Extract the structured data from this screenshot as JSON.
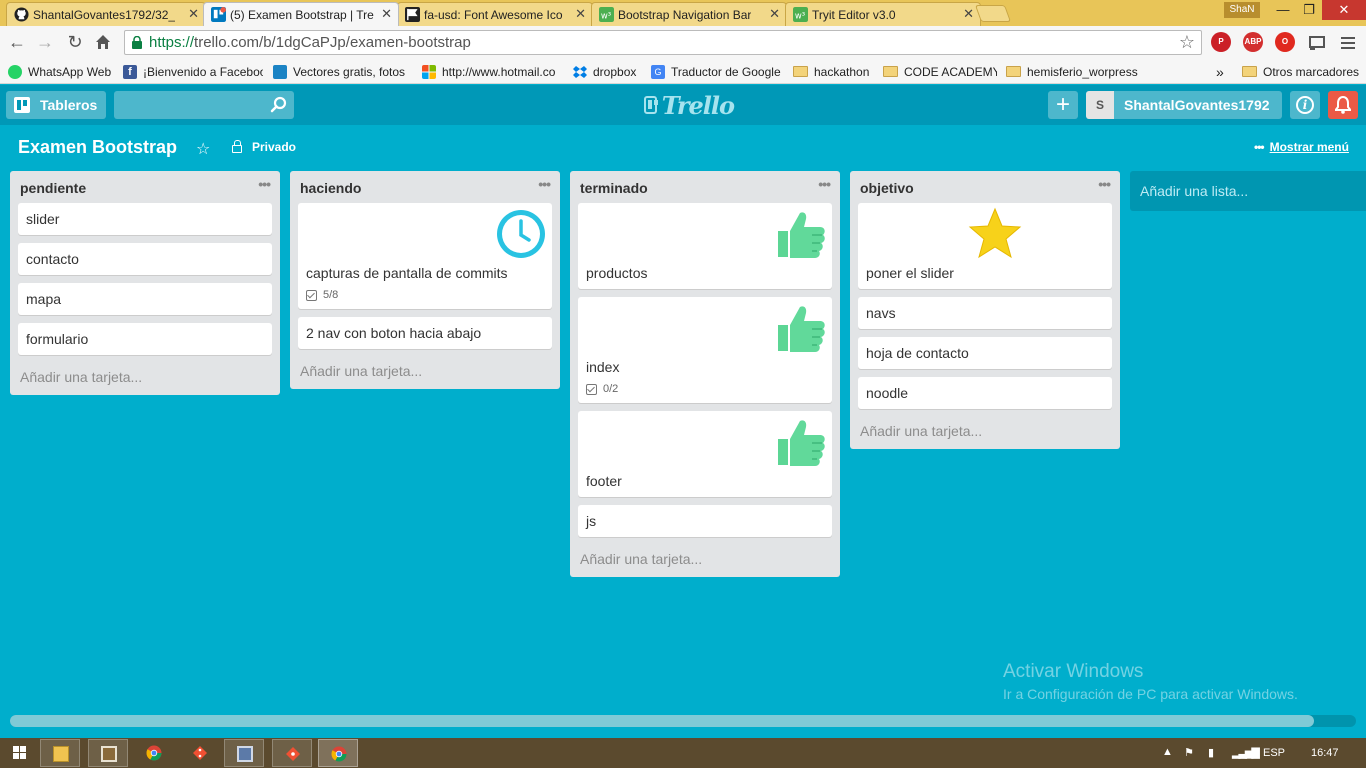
{
  "browser": {
    "tabs": [
      {
        "title": "ShantalGovantes1792/32_",
        "favicon": "github-icon",
        "active": false
      },
      {
        "title": "(5) Examen Bootstrap | Tre",
        "favicon": "trello-icon",
        "active": true
      },
      {
        "title": "fa-usd: Font Awesome Ico",
        "favicon": "fontawesome-flag-icon",
        "active": false
      },
      {
        "title": "Bootstrap Navigation Bar",
        "favicon": "w3schools-icon",
        "active": false
      },
      {
        "title": "Tryit Editor v3.0",
        "favicon": "w3schools-icon",
        "active": false
      }
    ],
    "tab_close_glyph": "✕",
    "profile_name": "ShaN",
    "url_scheme": "https://",
    "url_rest": "trello.com/b/1dgCaPJp/examen-bootstrap",
    "extensions": [
      "pinterest-icon",
      "adblock-icon",
      "opera-icon",
      "cast-icon",
      "chrome-menu-icon"
    ],
    "extension_labels": {
      "adblock": "ABP"
    },
    "bookmarks": [
      {
        "label": "WhatsApp Web",
        "icon": "whatsapp-icon"
      },
      {
        "label": "¡Bienvenido a Faceboo",
        "icon": "facebook-icon"
      },
      {
        "label": "Vectores gratis, fotos",
        "icon": "freepik-icon"
      },
      {
        "label": "http://www.hotmail.co",
        "icon": "microsoft-icon"
      },
      {
        "label": "dropbox",
        "icon": "dropbox-icon"
      },
      {
        "label": "Traductor de Google",
        "icon": "google-translate-icon"
      },
      {
        "label": "hackathon",
        "icon": "folder-icon"
      },
      {
        "label": "CODE ACADEMY",
        "icon": "folder-icon"
      },
      {
        "label": "hemisferio_worpress",
        "icon": "folder-icon"
      }
    ],
    "bookmarks_overflow": "»",
    "other_bookmarks": "Otros marcadores"
  },
  "header": {
    "boards_label": "Tableros",
    "search_value": "",
    "logo_text": "Trello",
    "add_glyph": "+",
    "member_initial": "S",
    "member_name": "ShantalGovantes1792",
    "info_glyph": "i"
  },
  "board": {
    "title": "Examen Bootstrap",
    "star_glyph": "☆",
    "visibility": "Privado",
    "menu_dots": "•••",
    "show_menu": "Mostrar menú",
    "add_list": "Añadir una lista...",
    "add_card": "Añadir una tarjeta...",
    "list_menu_glyph": "•••",
    "lists": [
      {
        "title": "pendiente",
        "cards": [
          {
            "title": "slider"
          },
          {
            "title": "contacto"
          },
          {
            "title": "mapa"
          },
          {
            "title": "formulario"
          }
        ]
      },
      {
        "title": "haciendo",
        "cards": [
          {
            "title": "capturas de pantalla de commits",
            "sticker": "clock-sticker-icon",
            "checklist": "5/8"
          },
          {
            "title": "2 nav con boton hacia abajo"
          }
        ]
      },
      {
        "title": "terminado",
        "cards": [
          {
            "title": "productos",
            "sticker": "thumbs-up-sticker-icon"
          },
          {
            "title": "index",
            "sticker": "thumbs-up-sticker-icon",
            "checklist": "0/2"
          },
          {
            "title": "footer",
            "sticker": "thumbs-up-sticker-icon"
          },
          {
            "title": "js"
          }
        ]
      },
      {
        "title": "objetivo",
        "cards": [
          {
            "title": "poner el slider",
            "sticker": "star-sticker-icon"
          },
          {
            "title": "navs"
          },
          {
            "title": "hoja de contacto"
          },
          {
            "title": "noodle"
          }
        ]
      }
    ]
  },
  "overlay": {
    "activate_title": "Activar Windows",
    "activate_sub": "Ir a Configuración de PC para activar Windows."
  },
  "taskbar": {
    "language": "ESP",
    "clock": "16:47"
  },
  "colors": {
    "board_bg": "#00AECC",
    "header_bg": "#0098B7",
    "list_bg": "#E2E4E6",
    "notif": "#EB5A46",
    "tab_strip": "#E8C558"
  }
}
